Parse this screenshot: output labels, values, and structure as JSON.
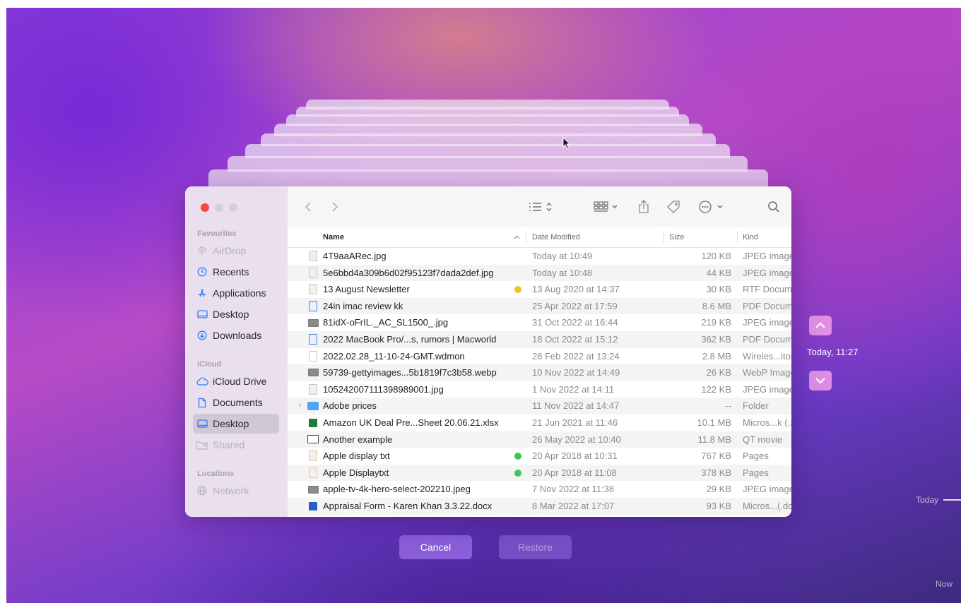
{
  "sidebar": {
    "favourites_title": "Favourites",
    "favourites": [
      {
        "label": "AirDrop",
        "icon": "airdrop-icon",
        "state": "dim"
      },
      {
        "label": "Recents",
        "icon": "clock-icon",
        "state": "normal"
      },
      {
        "label": "Applications",
        "icon": "applications-icon",
        "state": "normal"
      },
      {
        "label": "Desktop",
        "icon": "desktop-icon",
        "state": "normal"
      },
      {
        "label": "Downloads",
        "icon": "download-icon",
        "state": "normal"
      }
    ],
    "icloud_title": "iCloud",
    "icloud": [
      {
        "label": "iCloud Drive",
        "icon": "cloud-icon",
        "state": "normal"
      },
      {
        "label": "Documents",
        "icon": "document-icon",
        "state": "normal"
      },
      {
        "label": "Desktop",
        "icon": "desktop-icon",
        "state": "selected"
      },
      {
        "label": "Shared",
        "icon": "shared-folder-icon",
        "state": "dim"
      }
    ],
    "locations_title": "Locations",
    "locations": [
      {
        "label": "Network",
        "icon": "network-icon",
        "state": "dim"
      }
    ]
  },
  "columns": {
    "name": "Name",
    "date": "Date Modified",
    "size": "Size",
    "kind": "Kind"
  },
  "files": [
    {
      "name": "4T9aaARec.jpg",
      "date": "Today at 10:49",
      "size": "120 KB",
      "kind": "JPEG image",
      "icon": "image-file-icon"
    },
    {
      "name": "5e6bbd4a309b6d02f95123f7dada2def.jpg",
      "date": "Today at 10:48",
      "size": "44 KB",
      "kind": "JPEG image",
      "icon": "image-file-icon"
    },
    {
      "name": "13 August Newsletter",
      "date": "13 Aug 2020 at 14:37",
      "size": "30 KB",
      "kind": "RTF Document",
      "icon": "rtf-file-icon",
      "tag": "#f0c428"
    },
    {
      "name": "24in imac review kk",
      "date": "25 Apr 2022 at 17:59",
      "size": "8.6 MB",
      "kind": "PDF Document",
      "icon": "pdf-file-icon"
    },
    {
      "name": "81idX-oFrIL._AC_SL1500_.jpg",
      "date": "31 Oct 2022 at 16:44",
      "size": "219 KB",
      "kind": "JPEG image",
      "icon": "image-thumb-icon"
    },
    {
      "name": "2022 MacBook Pro/...s, rumors | Macworld",
      "date": "18 Oct 2022 at 15:12",
      "size": "362 KB",
      "kind": "PDF Document",
      "icon": "pdf-file-icon"
    },
    {
      "name": "2022.02.28_11-10-24-GMT.wdmon",
      "date": "28 Feb 2022 at 13:24",
      "size": "2.8 MB",
      "kind": "Wireles...itor",
      "icon": "file-icon"
    },
    {
      "name": "59739-gettyimages...5b1819f7c3b58.webp",
      "date": "10 Nov 2022 at 14:49",
      "size": "26 KB",
      "kind": "WebP Image",
      "icon": "image-thumb-icon"
    },
    {
      "name": "105242007111398989001.jpg",
      "date": "1 Nov 2022 at 14:11",
      "size": "122 KB",
      "kind": "JPEG image",
      "icon": "image-file-icon"
    },
    {
      "name": "Adobe prices",
      "date": "11 Nov 2022 at 14:47",
      "size": "--",
      "kind": "Folder",
      "icon": "folder-icon",
      "disclosure": "›"
    },
    {
      "name": "Amazon UK Deal Pre...Sheet 20.06.21.xlsx",
      "date": "21 Jun 2021 at 11:46",
      "size": "10.1 MB",
      "kind": "Micros...k (.xlsx)",
      "icon": "excel-file-icon"
    },
    {
      "name": "Another example",
      "date": "26 May 2022 at 10:40",
      "size": "11.8 MB",
      "kind": "QT movie",
      "icon": "movie-file-icon"
    },
    {
      "name": "Apple display txt",
      "date": "20 Apr 2018 at 10:31",
      "size": "767 KB",
      "kind": "Pages",
      "icon": "pages-file-icon",
      "tag": "#3ec857"
    },
    {
      "name": "Apple Displaytxt",
      "date": "20 Apr 2018 at 11:08",
      "size": "378 KB",
      "kind": "Pages",
      "icon": "pages-file-icon",
      "tag": "#3ec857"
    },
    {
      "name": "apple-tv-4k-hero-select-202210.jpeg",
      "date": "7 Nov 2022 at 11:38",
      "size": "29 KB",
      "kind": "JPEG image",
      "icon": "image-thumb-icon"
    },
    {
      "name": "Appraisal Form - Karen Khan 3.3.22.docx",
      "date": "8 Mar 2022 at 17:07",
      "size": "93 KB",
      "kind": "Micros...(.docx)",
      "icon": "word-file-icon"
    }
  ],
  "timemachine": {
    "current": "Today, 11:27",
    "timeline_today": "Today",
    "timeline_now": "Now",
    "cancel_label": "Cancel",
    "restore_label": "Restore"
  }
}
